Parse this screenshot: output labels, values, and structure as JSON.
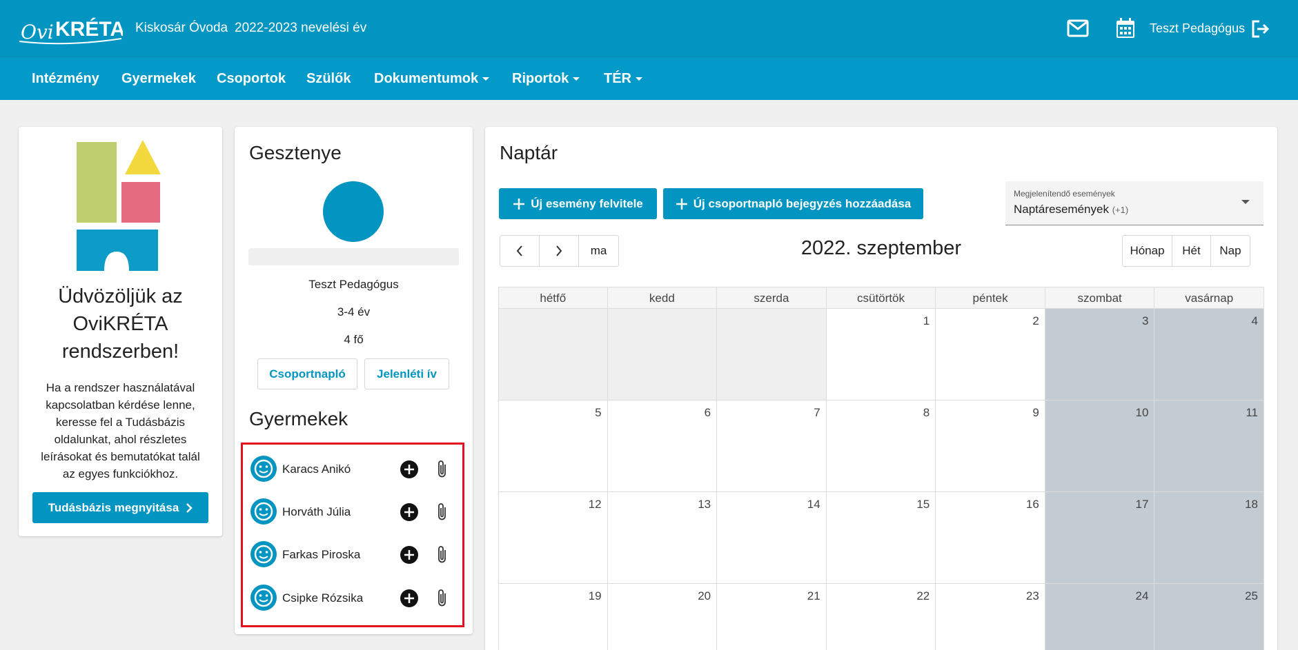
{
  "header": {
    "logo_text": "OviKRÉTA",
    "institution": "Kiskosár Óvoda",
    "school_year": "2022-2023 nevelési év",
    "user_name": "Teszt Pedagógus",
    "colors": {
      "primary": "#0295c2"
    }
  },
  "nav": {
    "items": [
      {
        "label": "Intézmény",
        "dropdown": false
      },
      {
        "label": "Gyermekek",
        "dropdown": false
      },
      {
        "label": "Csoportok",
        "dropdown": false
      },
      {
        "label": "Szülők",
        "dropdown": false
      },
      {
        "label": "Dokumentumok",
        "dropdown": true
      },
      {
        "label": "Riportok",
        "dropdown": true
      },
      {
        "label": "TÉR",
        "dropdown": true
      }
    ]
  },
  "welcome": {
    "title_lines": [
      "Üdvözöljük az",
      "OviKRÉTA",
      "rendszerben!"
    ],
    "text_lines": [
      "Ha a rendszer használatával",
      "kapcsolatban kérdése lenne,",
      "keresse fel a Tudásbázis",
      "oldalunkat, ahol részletes",
      "leírásokat és bemutatókat talál",
      "az egyes funkciókhoz."
    ],
    "button_label": "Tudásbázis megnyitása"
  },
  "group": {
    "name": "Gesztenye",
    "teacher": "Teszt Pedagógus",
    "age_range": "3-4 év",
    "count": "4 fő",
    "btn_journal": "Csoportnapló",
    "btn_attendance": "Jelenléti ív",
    "kids_title": "Gyermekek",
    "kids": [
      {
        "name": "Karacs Anikó"
      },
      {
        "name": "Horváth Júlia"
      },
      {
        "name": "Farkas Piroska"
      },
      {
        "name": "Csipke Rózsika"
      }
    ]
  },
  "calendar": {
    "title": "Naptár",
    "btn_new_event": "Új esemény felvitele",
    "btn_new_journal": "Új csoportnapló bejegyzés hozzáadása",
    "select_label": "Megjelenítendő események",
    "select_value": "Naptáresemények",
    "select_extra": "(+1)",
    "today_label": "ma",
    "month_title": "2022. szeptember",
    "views": [
      {
        "label": "Hónap",
        "active": true
      },
      {
        "label": "Hét",
        "active": false
      },
      {
        "label": "Nap",
        "active": false
      }
    ],
    "weekdays": [
      "hétfő",
      "kedd",
      "szerda",
      "csütörtök",
      "péntek",
      "szombat",
      "vasárnap"
    ],
    "weeks": [
      [
        "",
        "",
        "",
        "1",
        "2",
        "3",
        "4"
      ],
      [
        "5",
        "6",
        "7",
        "8",
        "9",
        "10",
        "11"
      ],
      [
        "12",
        "13",
        "14",
        "15",
        "16",
        "17",
        "18"
      ],
      [
        "19",
        "20",
        "21",
        "22",
        "23",
        "24",
        "25"
      ]
    ],
    "colors": {
      "weekend": "#c3cbd3",
      "other_month": "#efefef"
    }
  }
}
